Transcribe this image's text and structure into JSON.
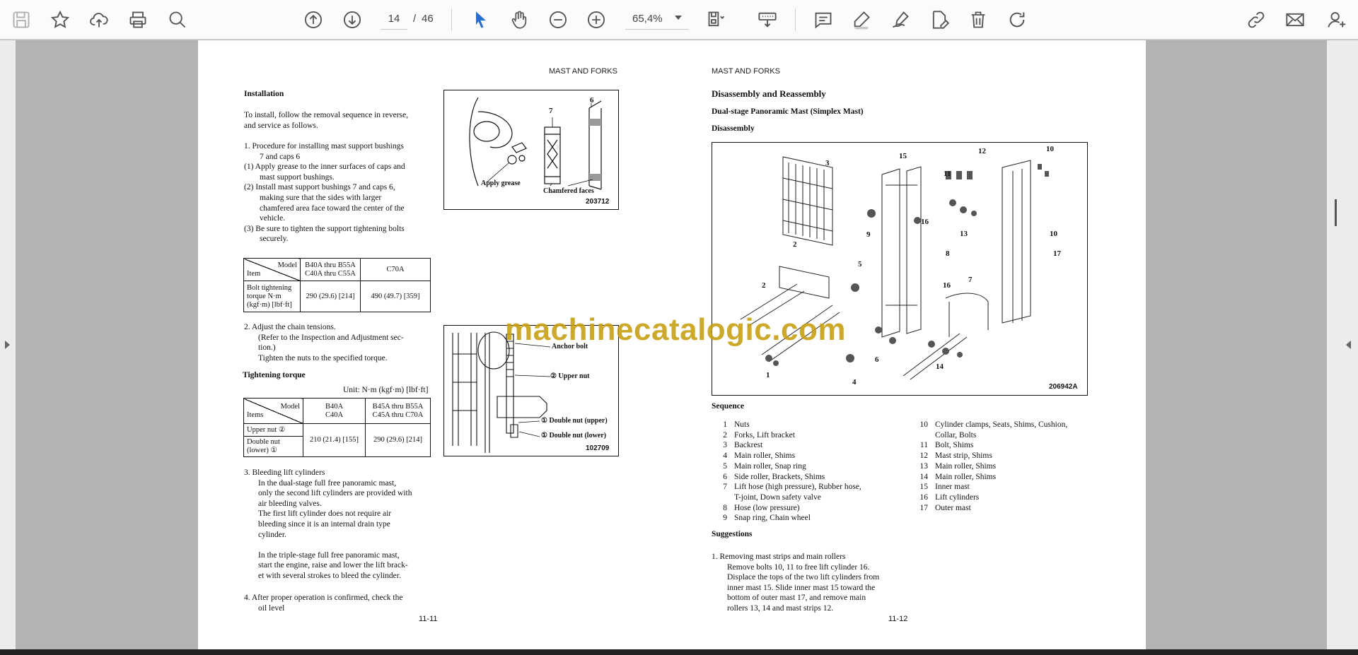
{
  "toolbar": {
    "page_current": "14",
    "page_slash": "/",
    "page_total": "46",
    "zoom": "65,4%",
    "icons": [
      "save-icon",
      "bookmark-star-icon",
      "cloud-upload-icon",
      "print-icon",
      "zoom-search-icon",
      "page-up-icon",
      "page-down-icon",
      "select-cursor-icon",
      "hand-tool-icon",
      "zoom-out-icon",
      "zoom-in-icon",
      "fit-page-icon",
      "stamp-icon",
      "comment-icon",
      "highlight-pen-icon",
      "sign-icon",
      "edit-icon",
      "delete-icon",
      "rotate-icon",
      "link-icon",
      "mail-icon",
      "add-user-icon"
    ]
  },
  "watermark": "machinecatalogic.com",
  "left_page": {
    "header": "MAST AND FORKS",
    "installation_title": "Installation",
    "intro": [
      "To install, follow the removal sequence in reverse,",
      "and service as follows."
    ],
    "step1": [
      "1.   Procedure for installing mast support bushings",
      "7 and caps 6"
    ],
    "step1_subs": [
      [
        "(1)  Apply grease to the inner surfaces of caps and",
        "mast support bushings."
      ],
      [
        "(2)  Install mast support bushings 7 and caps 6,",
        "making sure that the sides with larger",
        "chamfered area face toward the center of the",
        "vehicle."
      ],
      [
        "(3)  Be sure to tighten the support tightening bolts",
        "securely."
      ]
    ],
    "table1": {
      "model_label": "Model",
      "item_label": "Item",
      "col1": [
        "B40A thru B55A",
        "C40A thru C55A"
      ],
      "col2": "C70A",
      "row_label": [
        "Bolt tightening",
        "torque N·m",
        "(kgf·m) [lbf·ft]"
      ],
      "val1": "290 (29.6) [214]",
      "val2": "490 (49.7) [359]"
    },
    "step2": [
      "2.   Adjust the chain tensions.",
      "(Refer to the Inspection and Adjustment sec-",
      "tion.)",
      "Tighten the nuts to the specified torque."
    ],
    "tightening_title": "Tightening torque",
    "unit": "Unit: N·m (kgf·m) [lbf·ft]",
    "table2": {
      "model_label": "Model",
      "items_label": "Items",
      "col1": [
        "B40A",
        "C40A"
      ],
      "col2": [
        "B45A thru B55A",
        "C45A thru C70A"
      ],
      "row1": "Upper nut ②",
      "row2": [
        "Double nut",
        "(lower) ①"
      ],
      "val1": "210 (21.4) [155]",
      "val2": "290 (29.6) [214]"
    },
    "step3": [
      "3.   Bleeding lift cylinders",
      "In the dual-stage full free panoramic mast,",
      "only the second lift cylinders are provided with",
      "air bleeding valves.",
      "The first lift cylinder does not require air",
      "bleeding since it is an internal drain type",
      "cylinder.",
      "",
      "In the triple-stage full free panoramic mast,",
      "start the engine, raise and lower the lift brack-",
      "et with several strokes to bleed the cylinder."
    ],
    "step4": [
      "4.   After proper operation is confirmed, check the",
      "oil level"
    ],
    "fig1": {
      "label7": "7",
      "label6": "6",
      "apply": "Apply grease",
      "chamfer": "Chamfered faces",
      "id": "203712"
    },
    "fig2": {
      "anchor": "Anchor bolt",
      "upper": "② Upper nut",
      "dn_upper": "① Double nut (upper)",
      "dn_lower": "① Double nut (lower)",
      "id": "102709"
    },
    "footer": "11-11"
  },
  "right_page": {
    "header": "MAST AND FORKS",
    "title": "Disassembly and Reassembly",
    "subtitle": "Dual-stage Panoramic Mast (Simplex Mast)",
    "section": "Disassembly",
    "fig_id": "206942A",
    "fig_labels": [
      "1",
      "2",
      "2",
      "3",
      "4",
      "5",
      "6",
      "7",
      "8",
      "9",
      "10",
      "10",
      "11",
      "12",
      "13",
      "14",
      "15",
      "16",
      "16",
      "17"
    ],
    "sequence_title": "Sequence",
    "sequence_left": [
      [
        "1",
        "Nuts"
      ],
      [
        "2",
        "Forks, Lift bracket"
      ],
      [
        "3",
        "Backrest"
      ],
      [
        "4",
        "Main roller, Shims"
      ],
      [
        "5",
        "Main roller, Snap ring"
      ],
      [
        "6",
        "Side roller, Brackets, Shims"
      ],
      [
        "7",
        "Lift hose (high pressure), Rubber hose,",
        "T-joint, Down safety valve"
      ],
      [
        "8",
        "Hose (low pressure)"
      ],
      [
        "9",
        "Snap ring, Chain wheel"
      ]
    ],
    "sequence_right": [
      [
        "10",
        "Cylinder clamps, Seats, Shims, Cushion,",
        "Collar, Bolts"
      ],
      [
        "11",
        "Bolt, Shims"
      ],
      [
        "12",
        "Mast strip, Shims"
      ],
      [
        "13",
        "Main roller, Shims"
      ],
      [
        "14",
        "Main roller, Shims"
      ],
      [
        "15",
        "Inner mast"
      ],
      [
        "16",
        "Lift cylinders"
      ],
      [
        "17",
        "Outer mast"
      ]
    ],
    "suggestions_title": "Suggestions",
    "suggestion1": [
      "1.   Removing mast strips and main rollers",
      "Remove bolts 10, 11 to free lift cylinder 16.",
      "Displace the tops of the two lift cylinders from",
      "inner mast 15. Slide inner mast 15 toward the",
      "bottom of outer mast 17, and remove main",
      "rollers 13, 14 and mast strips 12."
    ],
    "footer": "11-12"
  }
}
